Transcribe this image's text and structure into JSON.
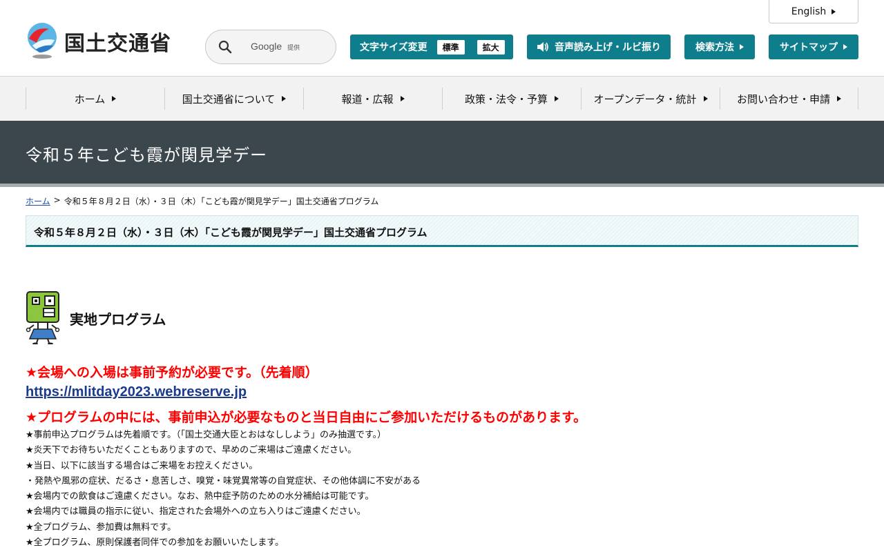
{
  "header": {
    "logo_text": "国土交通省",
    "search": {
      "placeholder": "",
      "brand": "Google",
      "brand_sub": "提供"
    },
    "english_label": "English",
    "font_size": {
      "label": "文字サイズ変更",
      "options": [
        "標準",
        "拡大"
      ]
    },
    "voice_label": "音声読み上げ・ルビ振り",
    "howto_label": "検索方法",
    "sitemap_label": "サイトマップ"
  },
  "nav": {
    "items": [
      {
        "label": "ホーム"
      },
      {
        "label": "国土交通省について"
      },
      {
        "label": "報道・広報"
      },
      {
        "label": "政策・法令・予算"
      },
      {
        "label": "オープンデータ・統計"
      },
      {
        "label": "お問い合わせ・申請"
      }
    ]
  },
  "page": {
    "title": "令和５年こども霞が関見学デー",
    "breadcrumb": {
      "home": "ホーム",
      "separator": ">",
      "current": "令和５年８月２日（水）・３日（木）「こども霞が関見学デー」国土交通省プログラム"
    },
    "section_heading": "令和５年８月２日（水）・３日（木）「こども霞が関見学デー」国土交通省プログラム",
    "program_title": "実地プログラム",
    "notice1": "★会場への入場は事前予約が必要です。（先着順）",
    "reserve_url": "https://mlitday2023.webreserve.jp",
    "notice2": "★プログラムの中には、事前申込が必要なものと当日自由にご参加いただけるものがあります。",
    "notes": [
      "★事前申込プログラムは先着順です。（「国土交通大臣とおはなししよう」のみ抽選です。）",
      "★炎天下でお待ちいただくこともありますので、早めのご来場はご遠慮ください。",
      "★当日、以下に該当する場合はご来場をお控えください。",
      "・発熱や風邪の症状、だるさ・息苦しさ、嗅覚・味覚異常等の自覚症状、その他体調に不安がある",
      "★会場内での飲食はご遠慮ください。なお、熱中症予防のための水分補給は可能です。",
      "★会場内では職員の指示に従い、指定された会場外への立ち入りはご遠慮ください。",
      "★全プログラム、参加費は無料です。",
      "★全プログラム、原則保護者同伴での参加をお願いいたします。"
    ]
  },
  "colors": {
    "accent": "#0e7d8c",
    "title_band": "#3b474d",
    "notice_red": "#ff0000",
    "link_blue": "#1a3a8c"
  },
  "icons": [
    "mlit-logo-icon",
    "search-icon",
    "speaker-icon",
    "triangle-right-icon",
    "mascot-character-icon"
  ]
}
